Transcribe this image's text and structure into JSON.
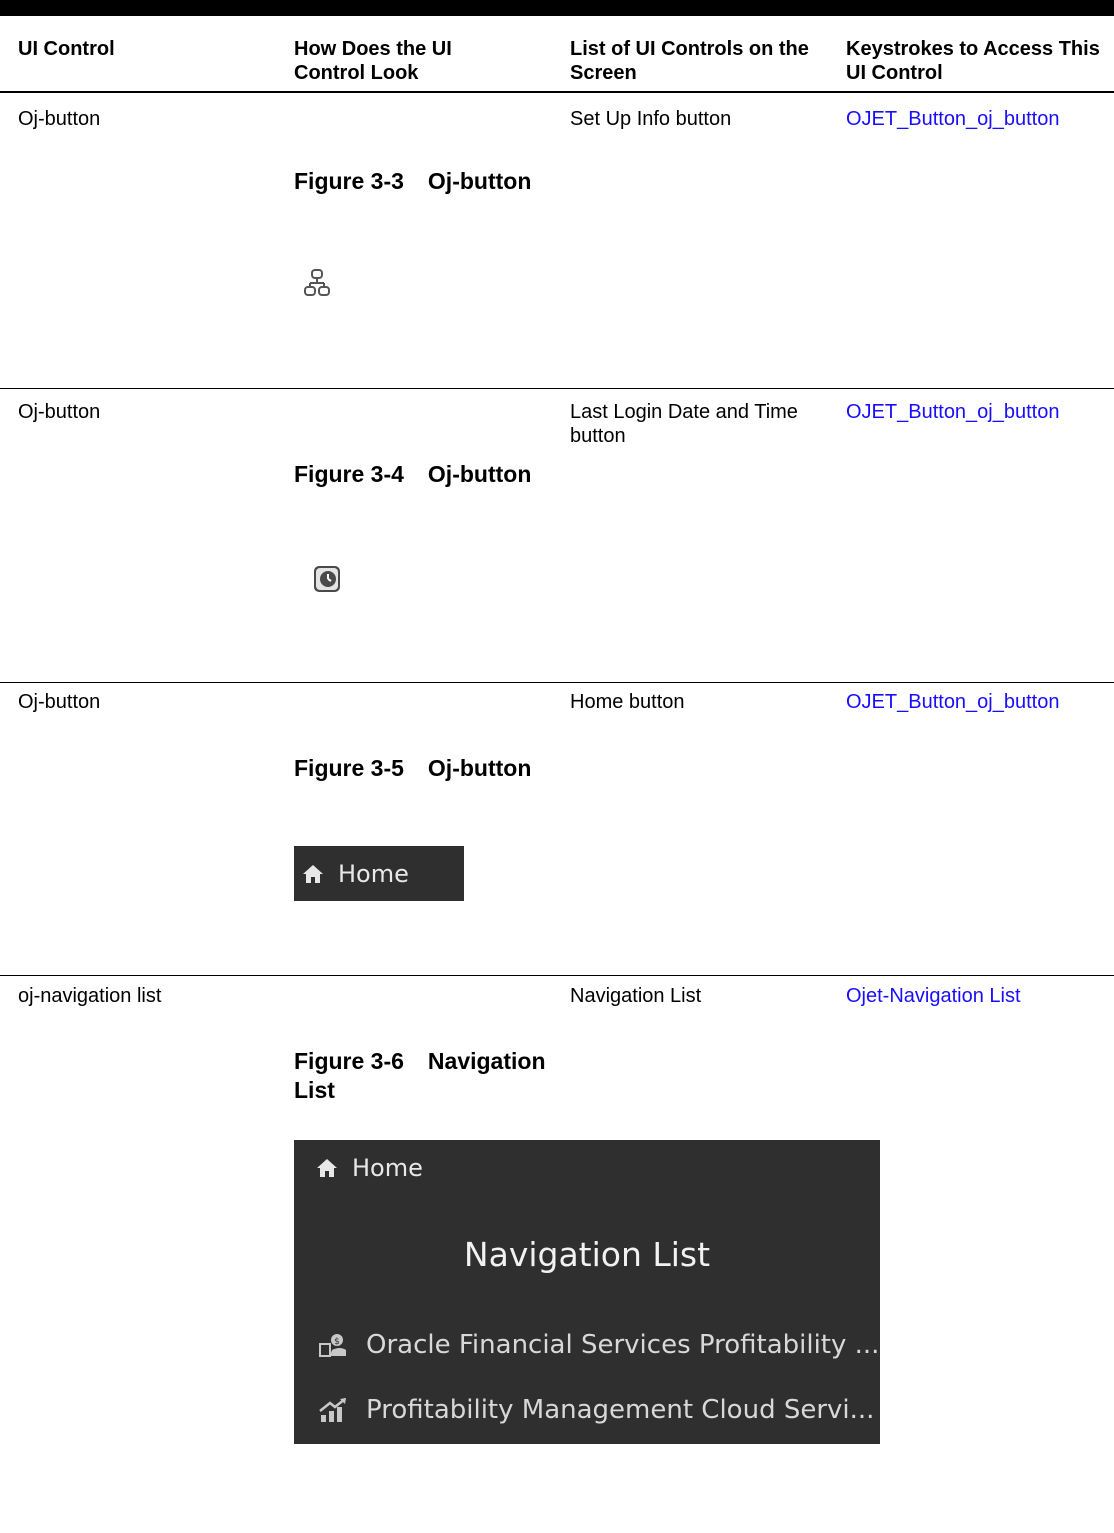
{
  "table": {
    "headers": [
      "UI Control",
      "How Does the UI Control Look",
      "List of UI Controls on the Screen",
      "Keystrokes to Access This UI Control"
    ],
    "rows": [
      {
        "control": "Oj-button",
        "figure_number": "Figure 3-3",
        "figure_caption": "Oj-button",
        "figure_icon": "org-chart-icon",
        "list": "Set Up Info button",
        "keystrokes": "OJET_Button_oj_button"
      },
      {
        "control": "Oj-button",
        "figure_number": "Figure 3-4",
        "figure_caption": "Oj-button",
        "figure_icon": "clock-icon",
        "list": "Last Login Date and Time button",
        "keystrokes": "OJET_Button_oj_button"
      },
      {
        "control": "Oj-button",
        "figure_number": "Figure 3-5",
        "figure_caption": "Oj-button",
        "figure_image": {
          "label": "Home",
          "icon": "home-icon"
        },
        "list": "Home button",
        "keystrokes": "OJET_Button_oj_button"
      },
      {
        "control": "oj-navigation list",
        "figure_number": "Figure 3-6",
        "figure_caption": "Navigation List",
        "figure_image": {
          "home_label": "Home",
          "title": "Navigation List",
          "items": [
            {
              "label": "Oracle Financial Services Profitability ...",
              "icon": "money-bag-icon"
            },
            {
              "label": "Profitability Management Cloud Servi...",
              "icon": "growth-chart-icon"
            }
          ]
        },
        "list": "Navigation List",
        "keystrokes": "Ojet-Navigation List"
      }
    ]
  },
  "colors": {
    "link": "#1a0dff",
    "panel_background": "#2f2f2f",
    "panel_text": "#e8e8e8"
  }
}
